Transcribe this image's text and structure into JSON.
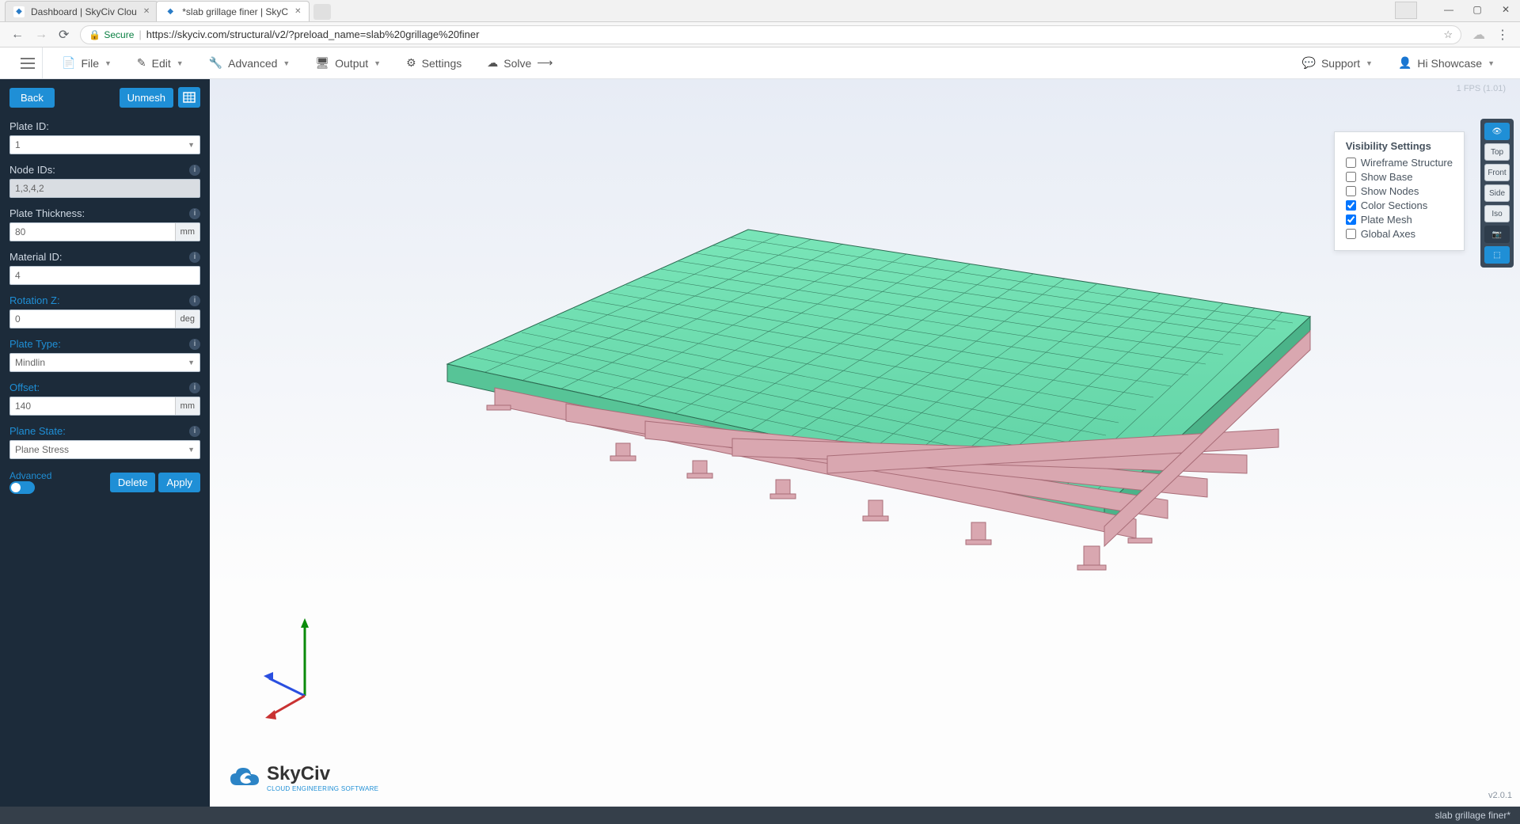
{
  "browser": {
    "tabs": [
      {
        "title": "Dashboard | SkyCiv Clou",
        "active": false
      },
      {
        "title": "*slab grillage finer | SkyC",
        "active": true
      }
    ],
    "secure_label": "Secure",
    "url": "https://skyciv.com/structural/v2/?preload_name=slab%20grillage%20finer"
  },
  "menu": {
    "file": "File",
    "edit": "Edit",
    "advanced": "Advanced",
    "output": "Output",
    "settings": "Settings",
    "solve": "Solve",
    "support": "Support",
    "user": "Hi Showcase"
  },
  "sidebar": {
    "back": "Back",
    "unmesh": "Unmesh",
    "plate_id": {
      "label": "Plate ID:",
      "value": "1"
    },
    "node_ids": {
      "label": "Node IDs:",
      "value": "1,3,4,2"
    },
    "thickness": {
      "label": "Plate Thickness:",
      "value": "80",
      "unit": "mm"
    },
    "material": {
      "label": "Material ID:",
      "value": "4"
    },
    "rotz": {
      "label": "Rotation Z:",
      "value": "0",
      "unit": "deg"
    },
    "ptype": {
      "label": "Plate Type:",
      "value": "Mindlin"
    },
    "offset": {
      "label": "Offset:",
      "value": "140",
      "unit": "mm"
    },
    "pstate": {
      "label": "Plane State:",
      "value": "Plane Stress"
    },
    "advanced": "Advanced",
    "delete": "Delete",
    "apply": "Apply"
  },
  "vis": {
    "title": "Visibility Settings",
    "wire": "Wireframe Structure",
    "base": "Show Base",
    "nodes": "Show Nodes",
    "color": "Color Sections",
    "mesh": "Plate Mesh",
    "axes": "Global Axes"
  },
  "viewbar": {
    "top": "Top",
    "front": "Front",
    "side": "Side",
    "iso": "Iso"
  },
  "fps": "1 FPS (1.01)",
  "logo": {
    "name": "SkyCiv",
    "sub": "CLOUD ENGINEERING SOFTWARE"
  },
  "version": "v2.0.1",
  "status": "slab grillage finer*"
}
